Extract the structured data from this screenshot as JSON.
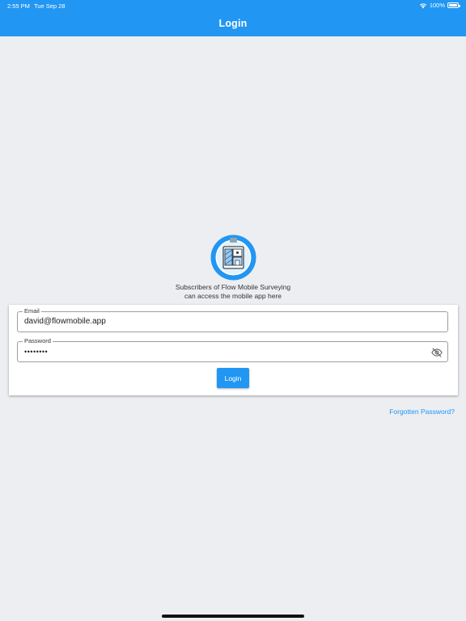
{
  "status_bar": {
    "time": "2:55 PM",
    "date": "Tue Sep 28",
    "battery": "100%"
  },
  "app_bar": {
    "title": "Login"
  },
  "logo": {
    "icon": "clipboard-floorplan-icon"
  },
  "tagline": {
    "line1": "Subscribers of Flow Mobile Surveying",
    "line2": "can access the mobile app here"
  },
  "form": {
    "email": {
      "label": "Email",
      "value": "david@flowmobile.app"
    },
    "password": {
      "label": "Password",
      "value": "••••••••",
      "toggle_icon": "visibility-off-icon"
    },
    "login_label": "Login"
  },
  "forgot_password": "Forgotten Password?",
  "colors": {
    "primary": "#2196F3",
    "background": "#ECEEF1",
    "card": "#FFFFFF"
  }
}
